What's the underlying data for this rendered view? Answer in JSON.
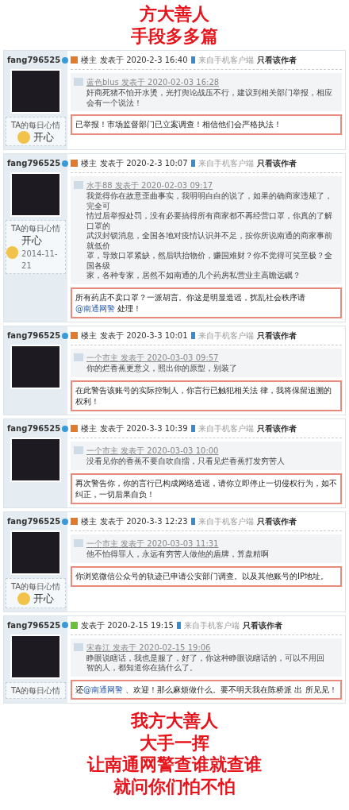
{
  "header": [
    "方大善人",
    "手段多多篇"
  ],
  "posts": [
    {
      "author": "fang796525",
      "mood": {
        "title": "TA的每日心情",
        "value": "开心"
      },
      "kind": "owner",
      "floor": "楼主",
      "posted": "发表于 2020-2-3 16:40",
      "client": "来自手机客户端",
      "only_author": "只看该作者",
      "quote_author": "蓝色blus 发表于 2020-02-03 16:28",
      "quote_lines": [
        "奸商死猪不怕开水烫，光打舆论战压不行，建议到相关部门举报，相应会有一个说法！"
      ],
      "reply": [
        {
          "kind": "text",
          "text": "已举报！市场监督部门已立案调查！相信他们会严格执法！"
        }
      ]
    },
    {
      "author": "fang796525",
      "mood": {
        "title": "TA的每日心情",
        "value": "开心",
        "date": "2014-11-21"
      },
      "kind": "owner",
      "floor": "楼主",
      "posted": "发表于 2020-2-3 10:07",
      "client": "来自手机客户端",
      "only_author": "只看该作者",
      "quote_author": "水手88 发表于 2020-02-03 09:17",
      "quote_lines": [
        "我觉得你在故意歪曲事实，我明明白白的说了，如果的确商家违规了，完全可",
        "情过后举报处罚，没有必要搞得所有商家都不再经营口罩，你真的了解口罩的",
        "武汉封锁消息，全国各地对疫情认识并不足，按你所说南通的商家事前就低价",
        "罩，导致口罩紧缺，然后哄抬物价，赚国难财？你不觉得可笑至极？全国各级",
        "家，各种专家，居然不如南通的几个药房私营业主高瞻远瞩？"
      ],
      "reply": [
        {
          "kind": "text",
          "text": "所有药店不卖口罩？一派胡言。你这是明显造谣，扰乱社会秩序请"
        },
        {
          "kind": "mention",
          "text": "@南通网警"
        },
        {
          "kind": "text",
          "text": " 处理！"
        }
      ]
    },
    {
      "author": "fang796525",
      "kind": "owner",
      "floor": "楼主",
      "posted": "发表于 2020-3-3 10:01",
      "client": "来自手机客户端",
      "only_author": "只看该作者",
      "quote_author": "一个市主 发表于 2020-03-03 09:57",
      "quote_lines": [
        "你的烂香蕉更意义，照出你的原型，别装了"
      ],
      "reply": [
        {
          "kind": "text",
          "text": "在此警告该账号的实际控制人，你言行已触犯相关法 律，我将保留追溯的权利！"
        }
      ]
    },
    {
      "author": "fang796525",
      "kind": "owner",
      "floor": "楼主",
      "posted": "发表于 2020-3-3 10:39",
      "client": "来自手机客户端",
      "only_author": "只看该作者",
      "quote_author": "一个市主 发表于 2020-03-03 10:00",
      "quote_lines": [
        "没看见你的香蕉不要自吹自擂，只看见烂香蕉打发穷苦人"
      ],
      "reply": [
        {
          "kind": "text",
          "text": "再次警告你，你的言行已构成网络造谣，请你立即停止一切侵权行为，如不纠正，一切后果自负！"
        }
      ]
    },
    {
      "author": "fang796525",
      "mood": {
        "title": "TA的每日心情",
        "value": "开心"
      },
      "kind": "owner",
      "floor": "楼主",
      "posted": "发表于 2020-3-3 12:23",
      "client": "来自手机客户端",
      "only_author": "只看该作者",
      "quote_author": "一个市主 发表于 2020-03-03 11:31",
      "quote_lines": [
        "他不怕得罪人，永远有穷苦人做他的盾牌，算盘精啊"
      ],
      "reply": [
        {
          "kind": "text",
          "text": "你浏览微信公众号的轨迹已申请公安部门调查。以及其他账号的IP地址。"
        }
      ]
    },
    {
      "author": "fang796525",
      "mood": {
        "title": "TA的每日心情"
      },
      "kind": "member",
      "posted": "发表于 2020-2-15 19:15",
      "client": "来自手机客户端",
      "only_author": "只看该作者",
      "quote_author": "宋春江 发表于 2020-02-15 19:06",
      "quote_lines": [
        "睁眼说瞎话，我也是服了，好了，你这种睁眼说瞎话的，可以不用回",
        "智的人，都知道你在搞什么了。"
      ],
      "reply": [
        {
          "kind": "text",
          "text": "还"
        },
        {
          "kind": "mention",
          "text": "@南通网警"
        },
        {
          "kind": "text",
          "text": " 、欢迎！那么麻烦做什么。要不明天我在陈桥派 出 所见见！"
        }
      ]
    }
  ],
  "footer": [
    "我方大善人",
    "大手一挥",
    "让南通网警查谁就查谁",
    "就问你们怕不怕"
  ]
}
